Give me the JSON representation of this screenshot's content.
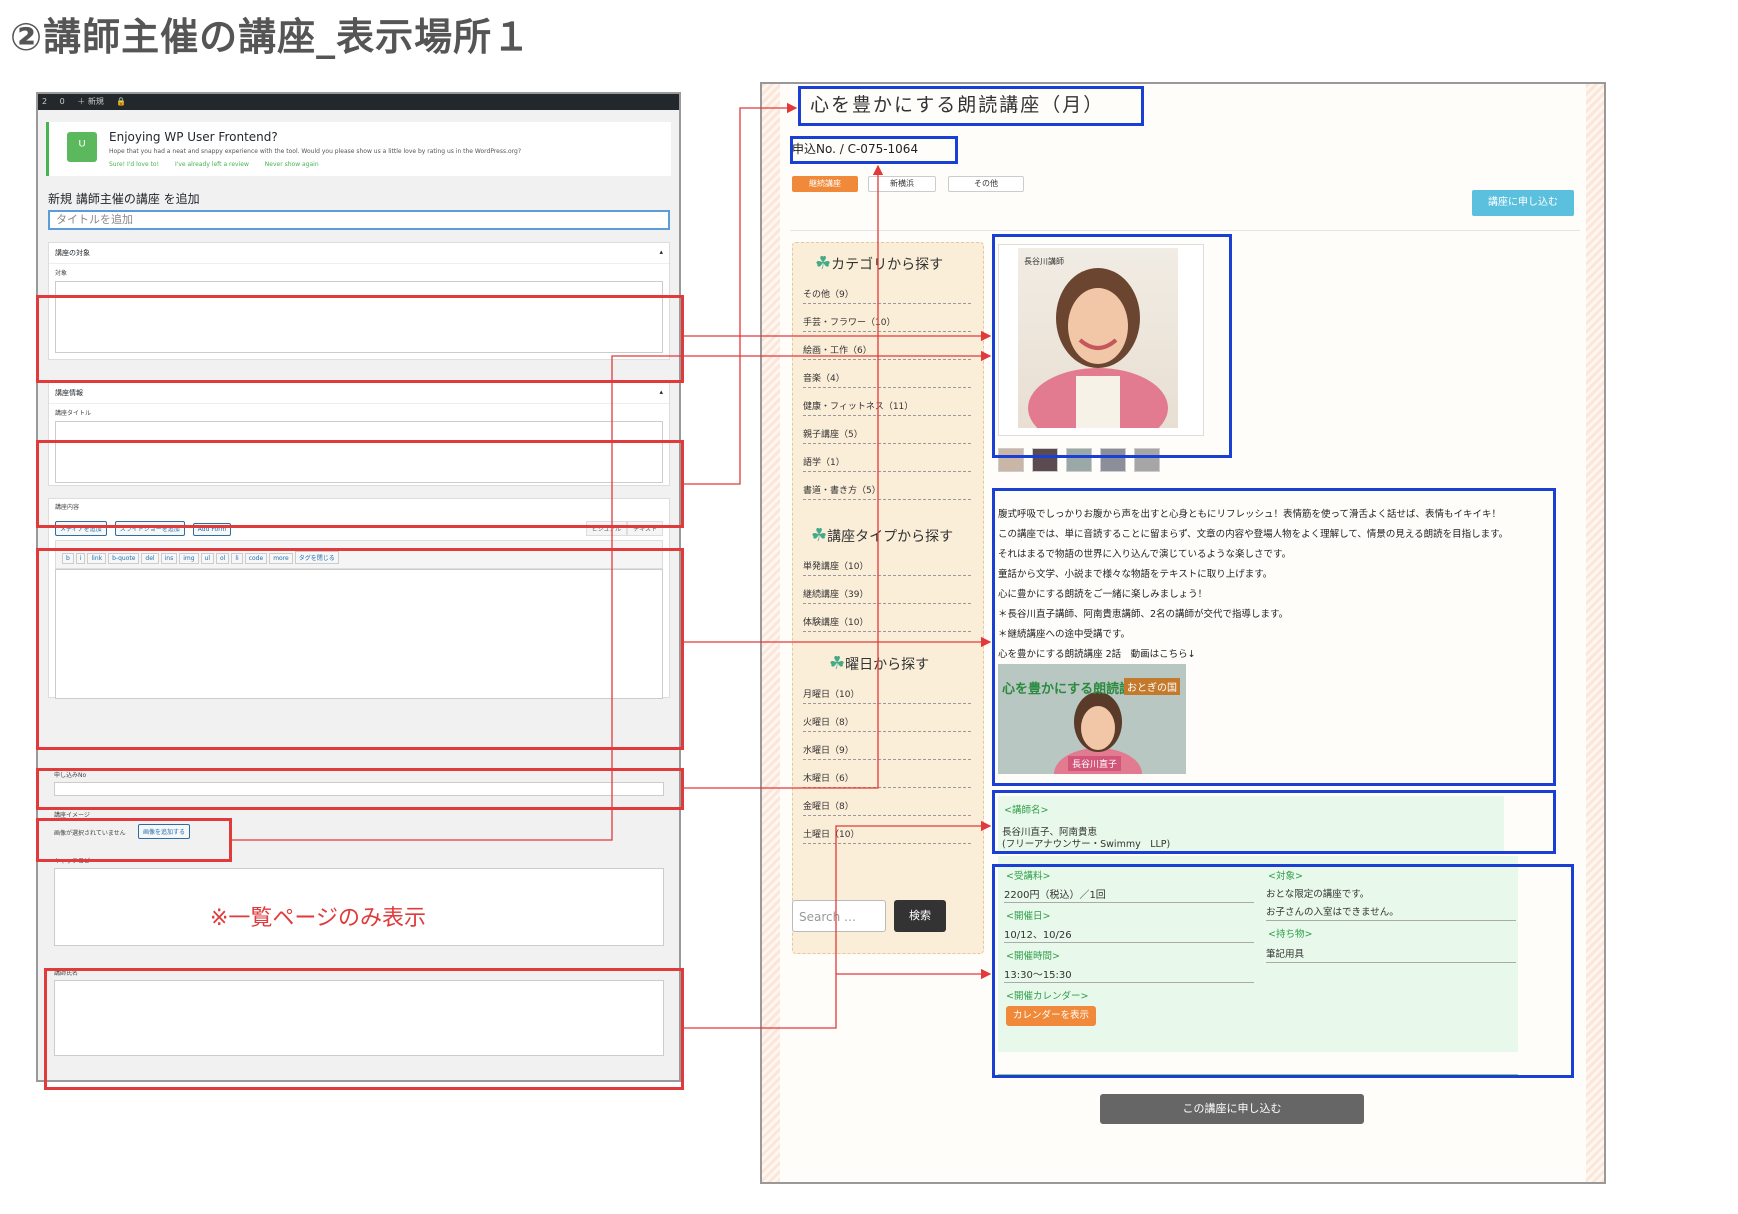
{
  "page_title": "②講師主催の講座_表示場所１",
  "wp": {
    "adminbar": {
      "updates": "2",
      "comments": "0",
      "new": "＋ 新規"
    },
    "notice": {
      "title": "Enjoying WP User Frontend?",
      "text": "Hope that you had a neat and snappy experience with the tool. Would you please show us a little love by rating us in the WordPress.org?",
      "link": "WordPress.org",
      "actions": [
        "Sure! I'd love to!",
        "I've already left a review",
        "Never show again"
      ]
    },
    "heading": "新規 講師主催の講座 を追加",
    "title_placeholder": "タイトルを追加",
    "box1": {
      "header": "講座の対象",
      "field_label": "対象"
    },
    "box2": {
      "header": "講座情報",
      "field_label": "講座タイトル"
    },
    "editor": {
      "field_label": "講座内容",
      "media_buttons": [
        "メディアを追加",
        "スライドショーを追加",
        "Add Form"
      ],
      "tabs": [
        "ビジュアル",
        "テキスト"
      ],
      "quicktags": [
        "b",
        "i",
        "link",
        "b-quote",
        "del",
        "ins",
        "img",
        "ul",
        "ol",
        "li",
        "code",
        "more",
        "タグを閉じる"
      ]
    },
    "application_no_label": "申し込みNo",
    "image_label": "講座イメージ",
    "image_status": "画像が選択されていません",
    "image_button": "画像を追加する",
    "catch_label": "キャッチコピー",
    "catch_note": "※一覧ページのみ表示",
    "lecturer_label": "講師氏名"
  },
  "site": {
    "course_title": "心を豊かにする朗読講座（月）",
    "course_no": "申込No. / C-075-1064",
    "tags": [
      "継続講座",
      "新横浜",
      "その他"
    ],
    "apply_top": "講座に申し込む",
    "sidebar": {
      "sections": [
        {
          "title": "カテゴリから探す",
          "items": [
            "その他（9）",
            "手芸・フラワー（10）",
            "絵画・工作（6）",
            "音楽（4）",
            "健康・フィットネス（11）",
            "親子講座（5）",
            "語学（1）",
            "書道・書き方（5）"
          ]
        },
        {
          "title": "講座タイプから探す",
          "items": [
            "単発講座（10）",
            "継続講座（39）",
            "体験講座（10）"
          ]
        },
        {
          "title": "曜日から探す",
          "items": [
            "月曜日（10）",
            "火曜日（8）",
            "水曜日（9）",
            "木曜日（6）",
            "金曜日（8）",
            "土曜日（10）"
          ]
        }
      ],
      "search_placeholder": "Search …",
      "search_button": "検索"
    },
    "photo_caption": "長谷川講師",
    "description": [
      "腹式呼吸でしっかりお腹から声を出すと心身ともにリフレッシュ！表情筋を使って滑舌よく話せば、表情もイキイキ！",
      "この講座では、単に音読することに留まらず、文章の内容や登場人物をよく理解して、情景の見える朗読を目指します。",
      "それはまるで物語の世界に入り込んで演じているような楽しさです。",
      "童話から文学、小説まで様々な物語をテキストに取り上げます。",
      "心に豊かにする朗読をご一緒に楽しみましょう！",
      "＊長谷川直子講師、阿南貴恵講師、2名の講師が交代で指導します。",
      "＊継続講座への途中受講です。",
      "心を豊かにする朗読講座 2話　動画はこちら↓"
    ],
    "video": {
      "title_left": "心を豊かにする朗読講座",
      "title_right": "おとぎの国",
      "name": "長谷川直子"
    },
    "lecturer": {
      "label": "<講師名>",
      "names": "長谷川直子、阿南貴恵",
      "affiliation": "(フリーアナウンサー・Swimmy　LLP)"
    },
    "info": {
      "fee_label": "<受講料>",
      "fee": "2200円（税込）／1回",
      "date_label": "<開催日>",
      "date": "10/12、10/26",
      "time_label": "<開催時間>",
      "time": "13:30〜15:30",
      "calendar_label": "<開催カレンダー>",
      "calendar_button": "カレンダーを表示",
      "target_label": "<対象>",
      "target": [
        "おとな限定の講座です。",
        "お子さんの入室はできません。"
      ],
      "bring_label": "<持ち物>",
      "bring": "筆記用具"
    },
    "apply_bottom": "この講座に申し込む"
  },
  "colors": {
    "annotation_red": "#e03a3a",
    "annotation_blue": "#1a3fd4",
    "accent_orange": "#f08a3a",
    "light_green": "#e8f8ea"
  }
}
